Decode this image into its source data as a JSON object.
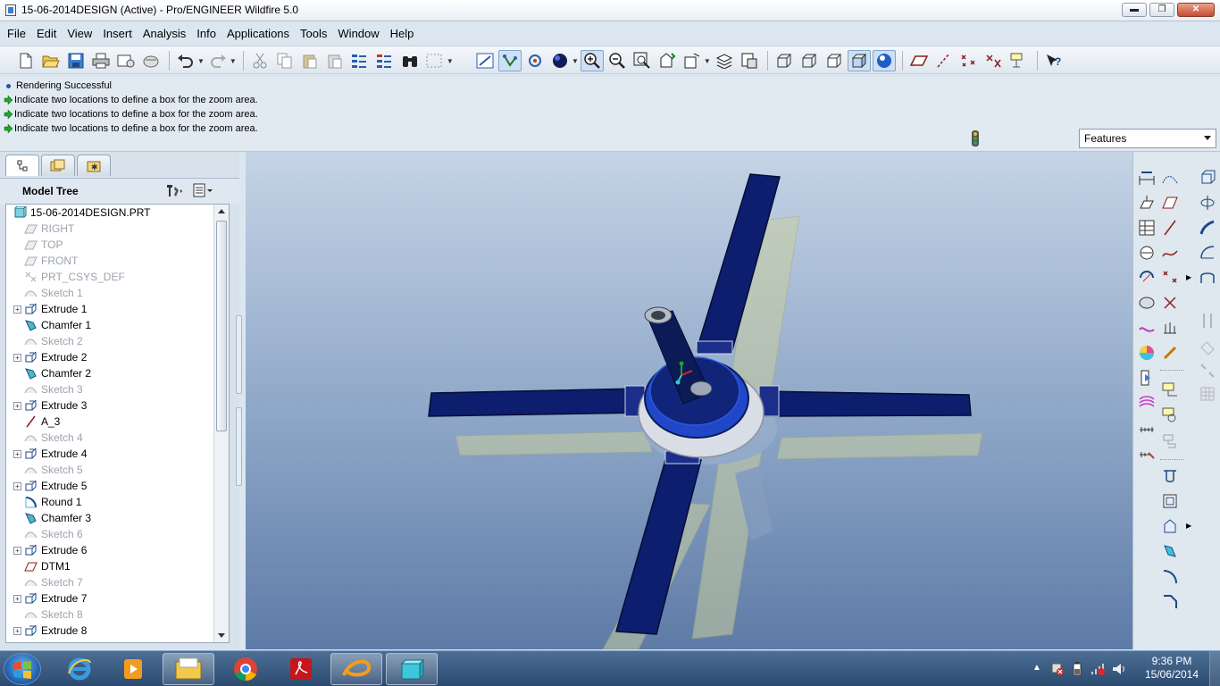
{
  "window": {
    "title": "15-06-2014DESIGN (Active) - Pro/ENGINEER Wildfire 5.0",
    "min_label": "▬",
    "max_label": "❐",
    "close_label": "✕"
  },
  "menu": [
    "File",
    "Edit",
    "View",
    "Insert",
    "Analysis",
    "Info",
    "Applications",
    "Tools",
    "Window",
    "Help"
  ],
  "messages": [
    {
      "icon": "bullet",
      "text": "Rendering Successful"
    },
    {
      "icon": "green-arrow",
      "text": "Indicate two locations to define a box for the zoom area."
    },
    {
      "icon": "green-arrow",
      "text": "Indicate two locations to define a box for the zoom area."
    },
    {
      "icon": "green-arrow",
      "text": "Indicate two locations to define a box for the zoom area."
    }
  ],
  "filter": {
    "selected": "Features"
  },
  "model_tree": {
    "label": "Model Tree",
    "root": "15-06-2014DESIGN.PRT",
    "items": [
      {
        "label": "RIGHT",
        "type": "plane",
        "dim": true,
        "expandable": false
      },
      {
        "label": "TOP",
        "type": "plane",
        "dim": true,
        "expandable": false
      },
      {
        "label": "FRONT",
        "type": "plane",
        "dim": true,
        "expandable": false
      },
      {
        "label": "PRT_CSYS_DEF",
        "type": "csys",
        "dim": true,
        "expandable": false
      },
      {
        "label": "Sketch 1",
        "type": "sketch",
        "dim": true,
        "expandable": false
      },
      {
        "label": "Extrude 1",
        "type": "extrude",
        "dim": false,
        "expandable": true
      },
      {
        "label": "Chamfer 1",
        "type": "chamfer",
        "dim": false,
        "expandable": false
      },
      {
        "label": "Sketch 2",
        "type": "sketch",
        "dim": true,
        "expandable": false
      },
      {
        "label": "Extrude 2",
        "type": "extrude",
        "dim": false,
        "expandable": true
      },
      {
        "label": "Chamfer 2",
        "type": "chamfer",
        "dim": false,
        "expandable": false
      },
      {
        "label": "Sketch 3",
        "type": "sketch",
        "dim": true,
        "expandable": false
      },
      {
        "label": "Extrude 3",
        "type": "extrude",
        "dim": false,
        "expandable": true
      },
      {
        "label": "A_3",
        "type": "axis",
        "dim": false,
        "expandable": false
      },
      {
        "label": "Sketch 4",
        "type": "sketch",
        "dim": true,
        "expandable": false
      },
      {
        "label": "Extrude 4",
        "type": "extrude",
        "dim": false,
        "expandable": true
      },
      {
        "label": "Sketch 5",
        "type": "sketch",
        "dim": true,
        "expandable": false
      },
      {
        "label": "Extrude 5",
        "type": "extrude",
        "dim": false,
        "expandable": true
      },
      {
        "label": "Round 1",
        "type": "round",
        "dim": false,
        "expandable": false
      },
      {
        "label": "Chamfer 3",
        "type": "chamfer",
        "dim": false,
        "expandable": false
      },
      {
        "label": "Sketch 6",
        "type": "sketch",
        "dim": true,
        "expandable": false
      },
      {
        "label": "Extrude 6",
        "type": "extrude",
        "dim": false,
        "expandable": true
      },
      {
        "label": "DTM1",
        "type": "datum",
        "dim": false,
        "expandable": false
      },
      {
        "label": "Sketch 7",
        "type": "sketch",
        "dim": true,
        "expandable": false
      },
      {
        "label": "Extrude 7",
        "type": "extrude",
        "dim": false,
        "expandable": true
      },
      {
        "label": "Sketch 8",
        "type": "sketch",
        "dim": true,
        "expandable": false
      },
      {
        "label": "Extrude 8",
        "type": "extrude",
        "dim": false,
        "expandable": true
      }
    ]
  },
  "toolbar": {
    "icons": [
      "new-icon",
      "open-icon",
      "save-icon",
      "print-icon",
      "email-icon",
      "email-link-icon",
      "undo-icon",
      "redo-icon",
      "cut-icon",
      "copy-icon",
      "paste-icon",
      "paste-special-icon",
      "regenerate-icon",
      "regenerate-manager-icon",
      "find-icon",
      "select-box-icon",
      "repaint-icon",
      "spin-center-icon",
      "orient-mode-icon",
      "appearance-gallery-icon",
      "zoom-in-icon",
      "zoom-out-icon",
      "refit-icon",
      "reorient-icon",
      "saved-views-icon",
      "layers-icon",
      "view-manager-icon",
      "wireframe-icon",
      "hidden-line-icon",
      "no-hidden-icon",
      "shading-icon",
      "enhanced-realism-icon",
      "datum-planes-icon",
      "datum-axes-icon",
      "datum-points-icon",
      "csys-icon",
      "annotations-icon",
      "context-help-icon"
    ]
  },
  "taskbar": {
    "apps": [
      "internet-explorer-icon",
      "media-player-icon",
      "file-explorer-icon",
      "chrome-icon",
      "acrobat-icon",
      "proe-icon",
      "proe-window-icon"
    ],
    "time": "9:36 PM",
    "date": "15/06/2014"
  },
  "colors": {
    "blade": "#0d1e6e",
    "viewport_top": "#c5d4e6",
    "viewport_bottom": "#5e7ba7",
    "shadow_blade": "#c9cfa0"
  }
}
